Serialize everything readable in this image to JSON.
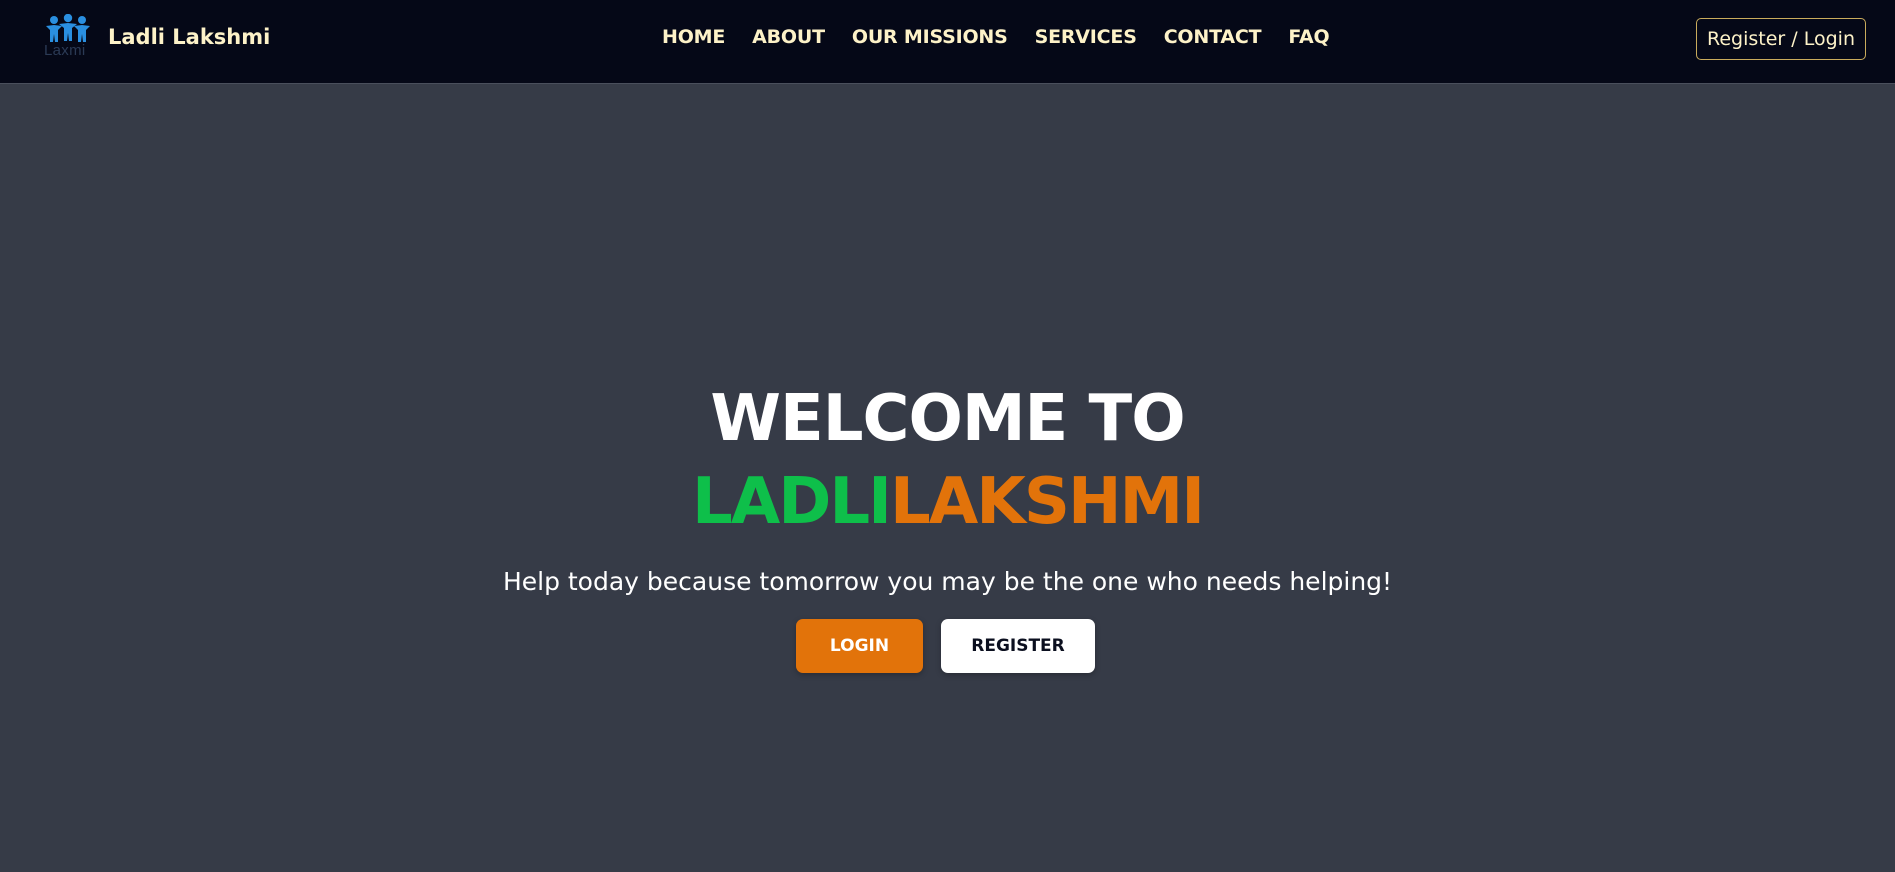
{
  "colors": {
    "navbar_bg": "#050817",
    "page_bg": "#363b47",
    "accent_cream": "#fdf2c8",
    "brand_green": "#0ebf4a",
    "brand_orange": "#e2730a",
    "logo_blue": "#2a8fe0"
  },
  "brand": {
    "logo_text": "Laxmi",
    "logo_icon": "people-group-icon",
    "name": "Ladli Lakshmi"
  },
  "nav": {
    "items": [
      {
        "label": "HOME"
      },
      {
        "label": "ABOUT"
      },
      {
        "label": "OUR MISSIONS"
      },
      {
        "label": "SERVICES"
      },
      {
        "label": "CONTACT"
      },
      {
        "label": "FAQ"
      }
    ],
    "auth_button": "Register / Login"
  },
  "hero": {
    "title": "WELCOME TO",
    "name_part1": "LADLI",
    "name_part2": "LAKSHMI",
    "tagline": "Help today because tomorrow you may be the one who needs helping!",
    "login_label": "LOGIN",
    "register_label": "REGISTER"
  }
}
